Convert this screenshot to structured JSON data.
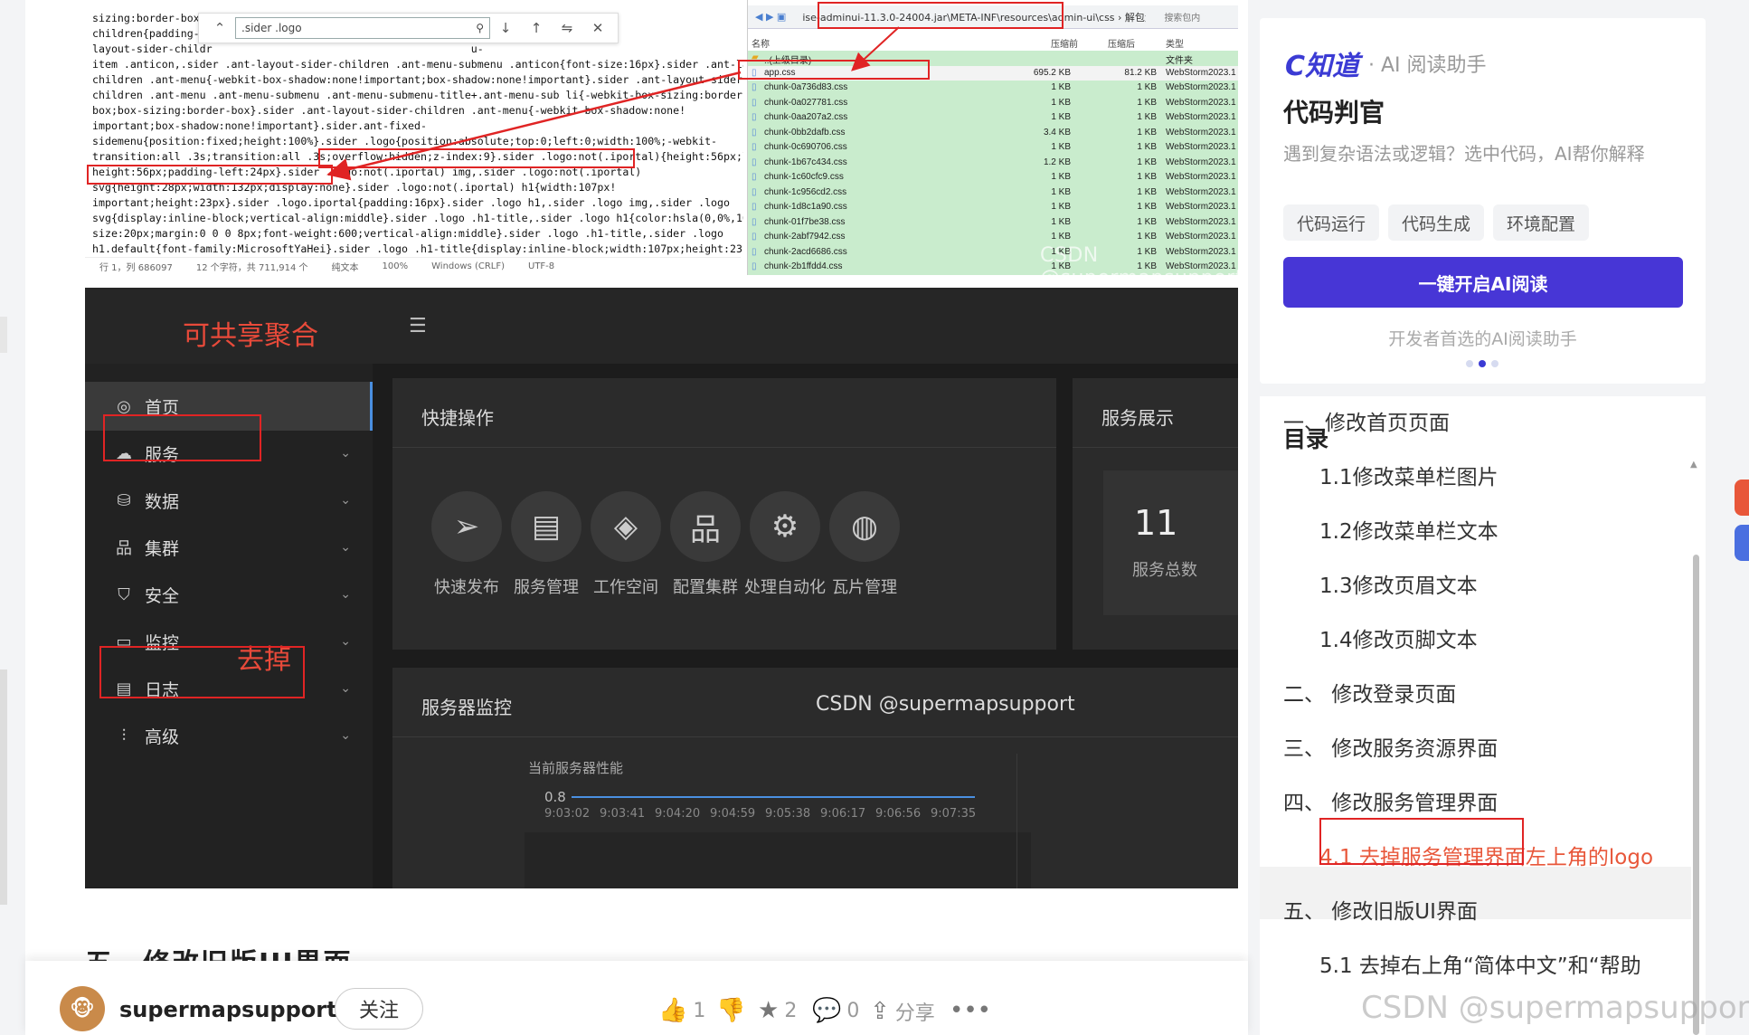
{
  "editor": {
    "find_value": ".sider .logo",
    "code_lines": [
      "sizing:border-box;/*...*/.sider .ant-layout-sider-",
      "children{padding-t                                        dden}.sider .ant-",
      "layout-sider-childr                                         u-",
      "item .anticon,.sider .ant-layout-sider-children .ant-menu-submenu .anticon{font-size:16px}.sider .ant-layout-sider-",
      "children .ant-menu{-webkit-box-shadow:none!important;box-shadow:none!important}.sider .ant-layout-sider-",
      "children .ant-menu .ant-menu-submenu .ant-menu-submenu-title+.ant-menu-sub li{-webkit-box-sizing:border-",
      "box;box-sizing:border-box}.sider .ant-layout-sider-children .ant-menu{-webkit-box-shadow:none!",
      "important;box-shadow:none!important}.sider.ant-fixed-",
      "sidemenu{position:fixed;height:100%}.sider .logo{position:absolute;top:0;left:0;width:100%;-webkit-",
      "transition:all .3s;transition:all .3s;overflow:hidden;z-index:9}.sider .logo:not(.iportal){height:56px;line-",
      "height:56px;padding-left:24px}.sider .logo:not(.iportal) img,.sider .logo:not(.iportal)",
      "svg{height:28px;width:132px;display:none}.sider .logo:not(.iportal) h1{width:107px!",
      "important;height:23px}.sider .logo.iportal{padding:16px}.sider .logo h1,.sider .logo img,.sider .logo",
      "svg{display:inline-block;vertical-align:middle}.sider .logo .h1-title,.sider .logo h1{color:hsla(0,0%,100%,.85);font-",
      "size:20px;margin:0 0 0 8px;font-weight:600;vertical-align:middle}.sider .logo .h1-title,.sider .logo",
      "h1.default{font-family:MicrosoftYaHei}.sider .logo .h1-title{display:inline-block;width:107px;height:23px;font-",
      "family:MicrosoftYaHei!important;color:#fff;line-height:24px;font-weight:300}.sider .collapse:not(.iportal)"
    ],
    "status": [
      "行 1，列 686097",
      "12 个字符，共 711,914 个",
      "纯文本",
      "100%",
      "Windows (CRLF)",
      "UTF-8"
    ]
  },
  "explorer": {
    "address": "ise-adminui-11.3.0-24004.jar\\META-INF\\resources\\admin-ui\\css › 解包大小为",
    "search_placeholder": "搜索包内",
    "columns": [
      "名称",
      "压缩前",
      "压缩后",
      "类型"
    ],
    "parent_row": {
      "name": "..(上级目录)",
      "type": "文件夹"
    },
    "files": [
      {
        "name": "app.css",
        "size": "695.2 KB",
        "packed": "81.2 KB",
        "type": "WebStorm2023.1"
      },
      {
        "name": "chunk-0a736d83.css",
        "size": "1 KB",
        "packed": "1 KB",
        "type": "WebStorm2023.1"
      },
      {
        "name": "chunk-0a027781.css",
        "size": "1 KB",
        "packed": "1 KB",
        "type": "WebStorm2023.1"
      },
      {
        "name": "chunk-0aa207a2.css",
        "size": "1 KB",
        "packed": "1 KB",
        "type": "WebStorm2023.1"
      },
      {
        "name": "chunk-0bb2dafb.css",
        "size": "3.4 KB",
        "packed": "1 KB",
        "type": "WebStorm2023.1"
      },
      {
        "name": "chunk-0c690706.css",
        "size": "1 KB",
        "packed": "1 KB",
        "type": "WebStorm2023.1"
      },
      {
        "name": "chunk-1b67c434.css",
        "size": "1.2 KB",
        "packed": "1 KB",
        "type": "WebStorm2023.1"
      },
      {
        "name": "chunk-1c60cfc9.css",
        "size": "1 KB",
        "packed": "1 KB",
        "type": "WebStorm2023.1"
      },
      {
        "name": "chunk-1c956cd2.css",
        "size": "1 KB",
        "packed": "1 KB",
        "type": "WebStorm2023.1"
      },
      {
        "name": "chunk-1d8c1a90.css",
        "size": "1 KB",
        "packed": "1 KB",
        "type": "WebStorm2023.1"
      },
      {
        "name": "chunk-01f7be38.css",
        "size": "1 KB",
        "packed": "1 KB",
        "type": "WebStorm2023.1"
      },
      {
        "name": "chunk-2abf7942.css",
        "size": "1 KB",
        "packed": "1 KB",
        "type": "WebStorm2023.1"
      },
      {
        "name": "chunk-2acd6686.css",
        "size": "1 KB",
        "packed": "1 KB",
        "type": "WebStorm2023.1"
      },
      {
        "name": "chunk-2b1ffdd4.css",
        "size": "1 KB",
        "packed": "1 KB",
        "type": "WebStorm2023.1"
      }
    ],
    "watermark": "CSDN @supermapsupport"
  },
  "dark_ui": {
    "brand": "可共享聚合",
    "annotation_remove": "去掉",
    "sidebar": [
      {
        "label": "首页",
        "icon": "dashboard-icon",
        "glyph": "◎",
        "active": true,
        "chevron": false
      },
      {
        "label": "服务",
        "icon": "cloud-icon",
        "glyph": "☁",
        "active": false,
        "chevron": true
      },
      {
        "label": "数据",
        "icon": "database-icon",
        "glyph": "⛁",
        "active": false,
        "chevron": true
      },
      {
        "label": "集群",
        "icon": "cluster-icon",
        "glyph": "品",
        "active": false,
        "chevron": true
      },
      {
        "label": "安全",
        "icon": "shield-icon",
        "glyph": "⛉",
        "active": false,
        "chevron": true
      },
      {
        "label": "监控",
        "icon": "monitor-icon",
        "glyph": "▭",
        "active": false,
        "chevron": true
      },
      {
        "label": "日志",
        "icon": "log-icon",
        "glyph": "▤",
        "active": false,
        "chevron": true
      },
      {
        "label": "高级",
        "icon": "sliders-icon",
        "glyph": "⫶",
        "active": false,
        "chevron": true
      }
    ],
    "quick_ops_title": "快捷操作",
    "quick_ops": [
      {
        "label": "快速发布",
        "icon": "paper-plane-icon",
        "glyph": "➢"
      },
      {
        "label": "服务管理",
        "icon": "server-gear-icon",
        "glyph": "▤"
      },
      {
        "label": "工作空间",
        "icon": "workspace-icon",
        "glyph": "◈"
      },
      {
        "label": "配置集群",
        "icon": "cluster-config-icon",
        "glyph": "品"
      },
      {
        "label": "处理自动化",
        "icon": "automation-icon",
        "glyph": "⚙"
      },
      {
        "label": "瓦片管理",
        "icon": "globe-icon",
        "glyph": "◍"
      }
    ],
    "service_display_title": "服务展示",
    "service_count": "11",
    "service_count_label": "服务总数",
    "monitor_title": "服务器监控",
    "perf_label": "当前服务器性能",
    "perf_y": "0.8",
    "perf_times": [
      "9:03:02",
      "9:03:41",
      "9:04:20",
      "9:04:59",
      "9:05:38",
      "9:06:17",
      "9:06:56",
      "9:07:35"
    ],
    "watermark": "CSDN @supermapsupport"
  },
  "article": {
    "next_section_heading": "五、修改旧版UI界面",
    "author": "supermapsupport",
    "follow_label": "关注",
    "actions": [
      {
        "icon": "thumbs-up-icon",
        "glyph": "👍",
        "count": "1"
      },
      {
        "icon": "thumbs-down-icon",
        "glyph": "👎",
        "count": ""
      },
      {
        "icon": "star-icon",
        "glyph": "★",
        "count": "2"
      },
      {
        "icon": "comment-icon",
        "glyph": "💬",
        "count": "0"
      },
      {
        "icon": "share-icon",
        "glyph": "⇪",
        "count": "分享"
      },
      {
        "icon": "more-icon",
        "glyph": "•••",
        "count": ""
      }
    ]
  },
  "ai_card": {
    "logo": "C知道",
    "logo_sub": "· AI 阅读助手",
    "title": "代码判官",
    "desc": "遇到复杂语法或逻辑？选中代码，AI帮你解释",
    "tags": [
      "代码运行",
      "代码生成",
      "环境配置"
    ],
    "button": "一键开启AI阅读",
    "note": "开发者首选的AI阅读助手"
  },
  "toc": {
    "title": "目录",
    "items": [
      {
        "label": "一、修改首页页面",
        "level": 1,
        "selected": false
      },
      {
        "label": "1.1修改菜单栏图片",
        "level": 2,
        "selected": false
      },
      {
        "label": "1.2修改菜单栏文本",
        "level": 2,
        "selected": false
      },
      {
        "label": "1.3修改页眉文本",
        "level": 2,
        "selected": false
      },
      {
        "label": "1.4修改页脚文本",
        "level": 2,
        "selected": false
      },
      {
        "label": "二、 修改登录页面",
        "level": 1,
        "selected": false
      },
      {
        "label": "三、 修改服务资源界面",
        "level": 1,
        "selected": false
      },
      {
        "label": "四、 修改服务管理界面",
        "level": 1,
        "selected": false
      },
      {
        "label": "4.1 去掉服务管理界面左上角的logo",
        "level": 2,
        "selected": true
      },
      {
        "label": "五、 修改旧版UI界面",
        "level": 1,
        "selected": false
      },
      {
        "label": "5.1 去掉右上角“简体中文”和“帮助",
        "level": 2,
        "selected": false
      }
    ],
    "watermark": "CSDN @supermapsupport"
  },
  "colors": {
    "accent": "#4736d6",
    "annotation_red": "#e02424",
    "toc_selected": "#e8573a",
    "explorer_green": "#c9eccd"
  }
}
